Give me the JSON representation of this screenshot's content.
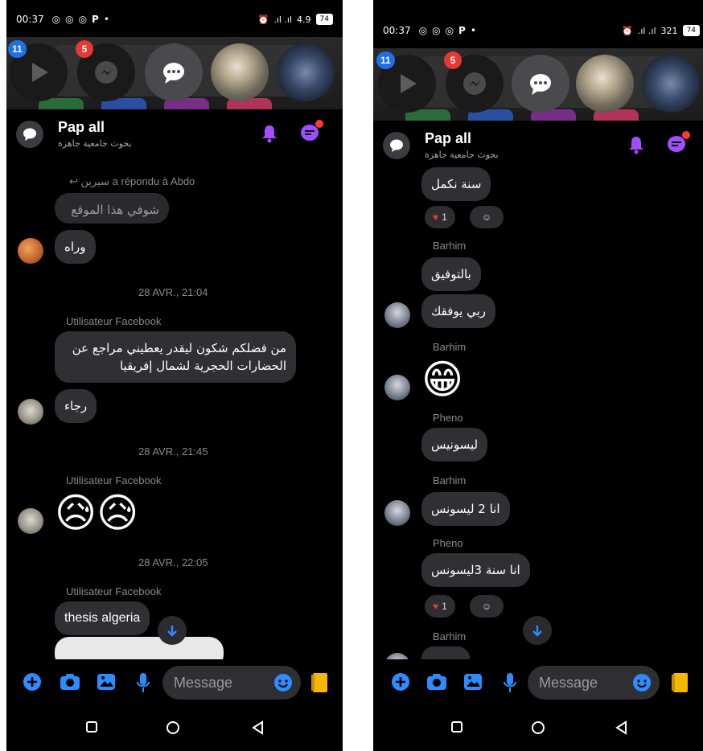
{
  "left": {
    "status": {
      "time": "00:37",
      "letter": "P",
      "net": "4.9",
      "battery": "74"
    },
    "heads": {
      "badge_video": "11",
      "badge_messenger": "5"
    },
    "chat": {
      "title": "Pap all",
      "subtitle": "بحوث جامعية جاهزة"
    },
    "reply_note": "سيرين a répondu à Abdo",
    "msg_quoted": "شوفي هذا الموقع",
    "msg_wrah": "وراه",
    "date1": "28 AVR., 21:04",
    "sender1": "Utilisateur Facebook",
    "msg_question": "من فضلكم شكون ليقدر يعطيني مراجع عن الحضارات الحجرية لشمال إفريقيا",
    "msg_rajaa": "رجاء",
    "date2": "28 AVR., 21:45",
    "sender2": "Utilisateur Facebook",
    "emoji_sad": "😥😥",
    "date3": "28 AVR., 22:05",
    "sender3": "Utilisateur Facebook",
    "msg_thesis": "thesis algeria",
    "composer": {
      "placeholder": "Message"
    }
  },
  "right": {
    "status": {
      "time": "00:37",
      "letter": "P",
      "net": "321",
      "battery": "74"
    },
    "heads": {
      "badge_video": "11",
      "badge_messenger": "5"
    },
    "chat": {
      "title": "Pap all",
      "subtitle": "بحوث جامعية جاهزة"
    },
    "msg_sana": "سنة نكمل",
    "reaction_count": "1",
    "sender_barhim": "Barhim",
    "msg_tawfiq": "بالتوفيق",
    "msg_rabbi": "ربي يوفقك",
    "emoji_grin": "😁",
    "sender_pheno": "Pheno",
    "msg_license": "ليسونيس",
    "msg_ana2": "انا 2 ليسونس",
    "msg_ana3": "انا سنة 3ليسونس",
    "reaction_count2": "1",
    "composer": {
      "placeholder": "Message"
    }
  },
  "colors": {
    "accent": "#2d8cff",
    "purple": "#a24dff",
    "bubble": "#303034"
  }
}
